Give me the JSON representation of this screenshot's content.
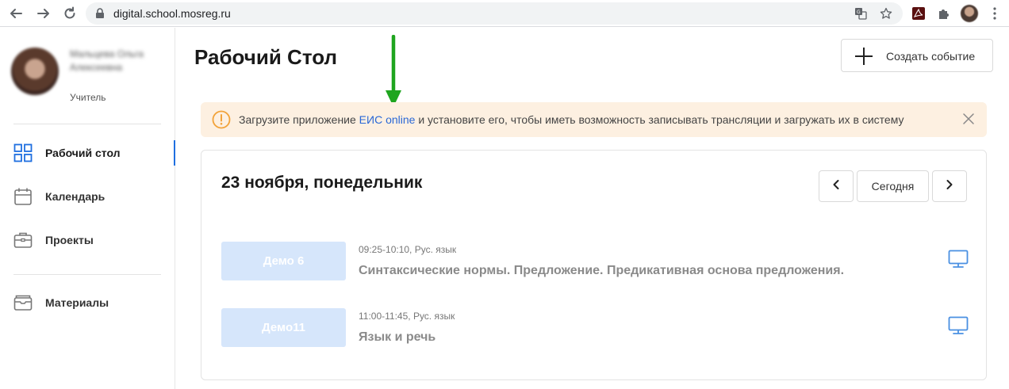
{
  "browser": {
    "url": "digital.school.mosreg.ru"
  },
  "user": {
    "name": "Мальцева Ольга Алексеевна",
    "role": "Учитель"
  },
  "sidebar": {
    "items": [
      {
        "label": "Рабочий стол",
        "icon": "dashboard-grid-icon",
        "active": true
      },
      {
        "label": "Календарь",
        "icon": "calendar-icon",
        "active": false
      },
      {
        "label": "Проекты",
        "icon": "briefcase-icon",
        "active": false
      },
      {
        "label": "Материалы",
        "icon": "wallet-icon",
        "active": false
      }
    ]
  },
  "header": {
    "title": "Рабочий Стол",
    "create_button": "Создать событие"
  },
  "banner": {
    "text_before": "Загрузите приложение ",
    "link": "ЕИС online",
    "text_after": " и установите его, чтобы иметь возможность записывать трансляции и загружать их в систему"
  },
  "schedule": {
    "date": "23 ноября, понедельник",
    "today_button": "Сегодня",
    "lessons": [
      {
        "badge": "Демо 6",
        "meta": "09:25-10:10, Рус. язык",
        "topic": "Синтаксические нормы. Предложение. Предикативная основа предложения."
      },
      {
        "badge": "Демо11",
        "meta": "11:00-11:45, Рус. язык",
        "topic": "Язык и речь"
      }
    ]
  },
  "colors": {
    "accent": "#1f6fe0",
    "link": "#2a68d6",
    "banner_bg": "#fdf0e1",
    "warning": "#f2a33a",
    "badge_bg": "#d6e6fb",
    "monitor": "#4a90e2",
    "annotation_arrow": "#1fa51f"
  }
}
